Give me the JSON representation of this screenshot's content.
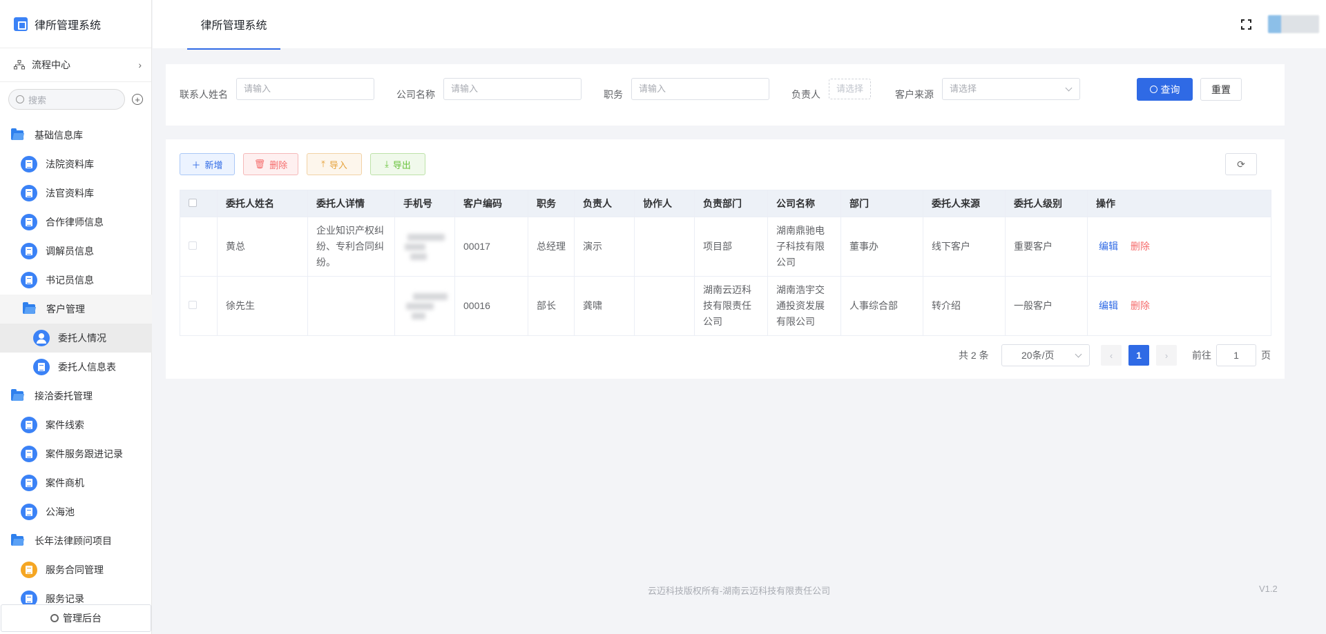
{
  "app": {
    "title": "律所管理系统"
  },
  "topbar": {
    "tab": "律所管理系统"
  },
  "sidebar": {
    "flow_center": "流程中心",
    "search_placeholder": "搜索",
    "groups": [
      {
        "label": "基础信息库",
        "items": [
          "法院资料库",
          "法官资料库",
          "合作律师信息",
          "调解员信息",
          "书记员信息"
        ]
      },
      {
        "label": "客户管理",
        "items": [
          "委托人情况",
          "委托人信息表"
        ]
      },
      {
        "label": "接洽委托管理",
        "items": [
          "案件线索",
          "案件服务跟进记录",
          "案件商机",
          "公海池"
        ]
      },
      {
        "label": "长年法律顾问项目",
        "items": [
          "服务合同管理",
          "服务记录"
        ]
      }
    ],
    "admin": "管理后台"
  },
  "filters": {
    "contact_name": {
      "label": "联系人姓名",
      "placeholder": "请输入"
    },
    "company": {
      "label": "公司名称",
      "placeholder": "请输入"
    },
    "position": {
      "label": "职务",
      "placeholder": "请输入"
    },
    "owner": {
      "label": "负责人",
      "placeholder": "请选择"
    },
    "source": {
      "label": "客户来源",
      "placeholder": "请选择"
    },
    "query": "查询",
    "reset": "重置"
  },
  "toolbar": {
    "add": "新增",
    "delete": "删除",
    "import": "导入",
    "export": "导出"
  },
  "table": {
    "headers": [
      "委托人姓名",
      "委托人详情",
      "手机号",
      "客户编码",
      "职务",
      "负责人",
      "协作人",
      "负责部门",
      "公司名称",
      "部门",
      "委托人来源",
      "委托人级别",
      "操作"
    ],
    "rows": [
      {
        "name": "黄总",
        "detail": "企业知识产权纠纷、专利合同纠纷。",
        "code": "00017",
        "position": "总经理",
        "owner": "演示",
        "collaborator": "",
        "dept_owner": "项目部",
        "company": "湖南鼎驰电子科技有限公司",
        "dept": "董事办",
        "source": "线下客户",
        "level": "重要客户",
        "edit": "编辑",
        "del": "删除"
      },
      {
        "name": "徐先生",
        "detail": "",
        "code": "00016",
        "position": "部长",
        "owner": "龚啸",
        "collaborator": "",
        "dept_owner": "湖南云迈科技有限责任公司",
        "company": "湖南浩宇交通投资发展有限公司",
        "dept": "人事综合部",
        "source": "转介绍",
        "level": "一般客户",
        "edit": "编辑",
        "del": "删除"
      }
    ]
  },
  "pagination": {
    "total": "共 2 条",
    "page_size": "20条/页",
    "current": "1",
    "goto_label": "前往",
    "goto_value": "1",
    "page_unit": "页"
  },
  "footer": {
    "copyright": "云迈科技版权所有-湖南云迈科技有限责任公司",
    "version": "V1.2"
  }
}
